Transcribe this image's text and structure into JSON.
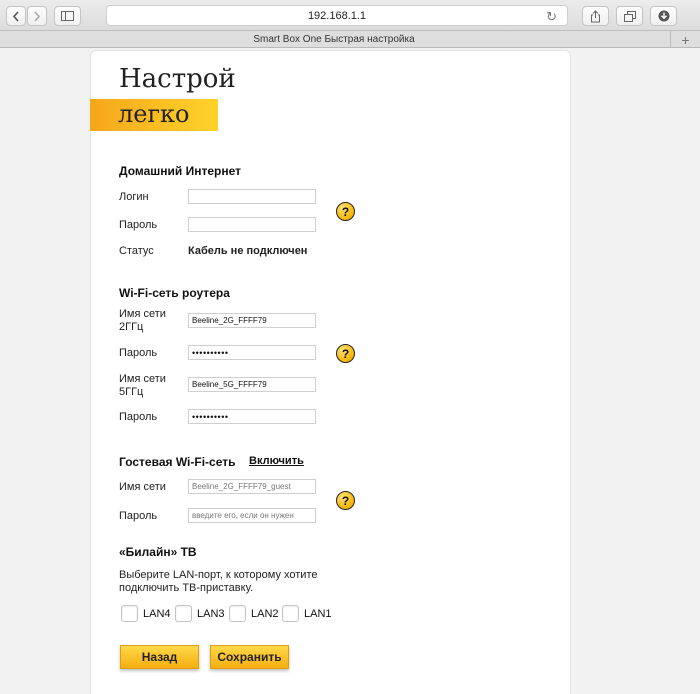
{
  "browser": {
    "address": "192.168.1.1",
    "tab_title": "Smart Box One Быстрая настройка",
    "new_tab_symbol": "+"
  },
  "logo": {
    "top": "Настрой",
    "bottom": "легко"
  },
  "home_internet": {
    "heading": "Домашний Интернет",
    "login_label": "Логин",
    "login_value": "",
    "password_label": "Пароль",
    "password_value": "",
    "status_label": "Статус",
    "status_value": "Кабель не подключен",
    "help": "?"
  },
  "wifi": {
    "heading": "Wi-Fi-сеть роутера",
    "ssid_2g_label_line1": "Имя сети",
    "ssid_2g_label_line2": "2ГГц",
    "ssid_2g_value": "Beeline_2G_FFFF79",
    "password_label": "Пароль",
    "password_2g_value": "••••••••••",
    "ssid_5g_label_line1": "Имя сети",
    "ssid_5g_label_line2": "5ГГц",
    "ssid_5g_value": "Beeline_5G_FFFF79",
    "password_5g_value": "••••••••••",
    "help": "?"
  },
  "guest_wifi": {
    "heading": "Гостевая Wi-Fi-сеть",
    "enable_link": "Включить",
    "ssid_label": "Имя сети",
    "ssid_placeholder": "Beeline_2G_FFFF79_guest",
    "password_label": "Пароль",
    "password_placeholder": "введите его, если он нужен",
    "help": "?"
  },
  "tv": {
    "heading": "«Билайн» ТВ",
    "description_line1": "Выберите LAN-порт, к которому хотите",
    "description_line2": "подключить ТВ-приставку.",
    "ports": [
      {
        "label": "LAN4",
        "checked": false
      },
      {
        "label": "LAN3",
        "checked": false
      },
      {
        "label": "LAN2",
        "checked": false
      },
      {
        "label": "LAN1",
        "checked": false
      }
    ]
  },
  "buttons": {
    "back": "Назад",
    "save": "Сохранить"
  }
}
